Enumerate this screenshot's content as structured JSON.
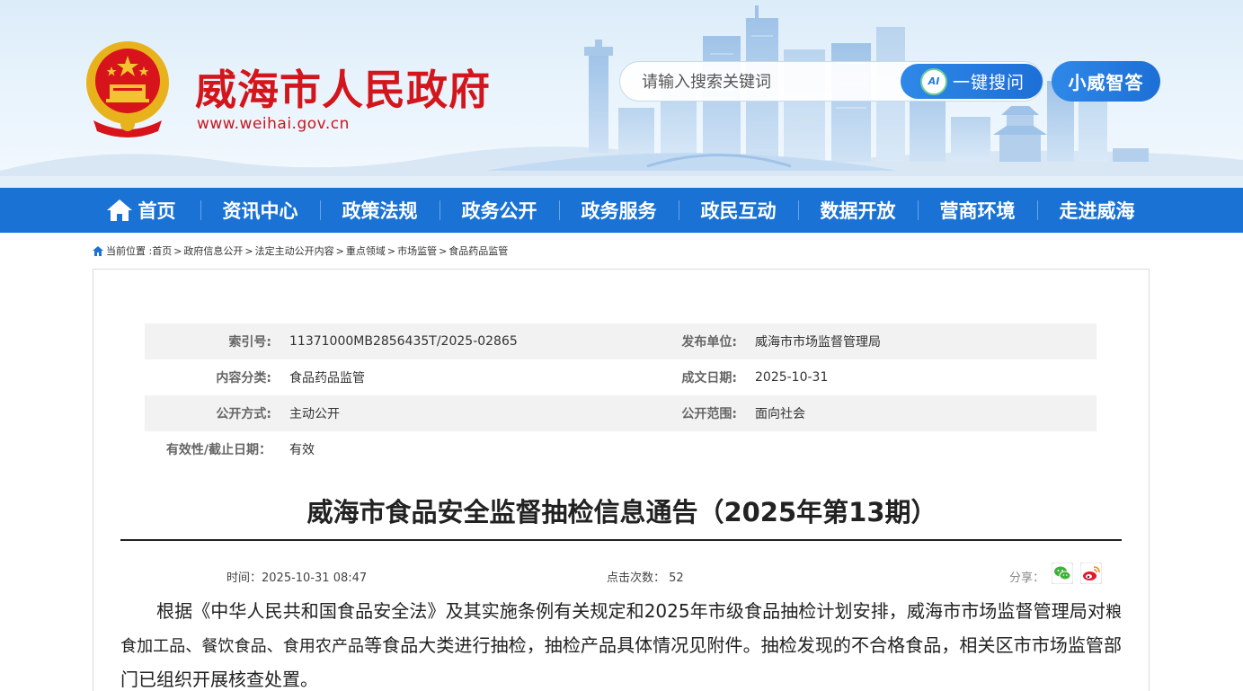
{
  "header": {
    "site_title": "威海市人民政府",
    "site_url": "www.weihai.gov.cn",
    "search_placeholder": "请输入搜索关键词",
    "ai_button_icon_text": "AI",
    "ai_button_label": "一键搜问",
    "assistant_button_label": "小威智答",
    "emblem": "national-emblem-icon"
  },
  "nav": {
    "items": [
      {
        "label": "首页",
        "icon": "home-icon"
      },
      {
        "label": "资讯中心"
      },
      {
        "label": "政策法规"
      },
      {
        "label": "政务公开"
      },
      {
        "label": "政务服务"
      },
      {
        "label": "政民互动"
      },
      {
        "label": "数据开放"
      },
      {
        "label": "营商环境"
      },
      {
        "label": "走进威海"
      }
    ],
    "background_color": "#1a73d4"
  },
  "breadcrumb": {
    "prefix": "当前位置 :",
    "items": [
      "首页",
      "政府信息公开",
      "法定主动公开内容",
      "重点领域",
      "市场监管",
      "食品药品监管"
    ],
    "separator": ">"
  },
  "meta": {
    "index_no_label": "索引号:",
    "index_no": "11371000MB2856435T/2025-02865",
    "publisher_label": "发布单位:",
    "publisher": "威海市市场监督管理局",
    "category_label": "内容分类:",
    "category": "食品药品监管",
    "date_label": "成文日期:",
    "date": "2025-10-31",
    "method_label": "公开方式:",
    "method": "主动公开",
    "scope_label": "公开范围:",
    "scope": "面向社会",
    "validity_label": "有效性/截止日期：",
    "validity": "有效"
  },
  "article": {
    "title": "威海市食品安全监督抽检信息通告（2025年第13期）",
    "time_label": "时间：",
    "time": "2025-10-31 08:47",
    "views_label": "点击次数：",
    "views": "52",
    "share_label": "分享：",
    "share_icons": [
      "wechat-icon",
      "weibo-icon"
    ],
    "body_part1": "根据《中华人民共和国食品安全法》及其实施条例有关规定和2025年市级食品抽检计划安排，威海市市场监督管理局对",
    "body_highlight": "粮食加工品、餐饮食品、食用农产品",
    "body_part2": "等食品大类进行抽检，抽检产品具体情况见附件。抽检发现的不合格食品，相关区市市场监管部门已组织开展核查处置。"
  },
  "colors": {
    "title_red": "#d3161b",
    "accent_blue": "#1a73d4"
  }
}
